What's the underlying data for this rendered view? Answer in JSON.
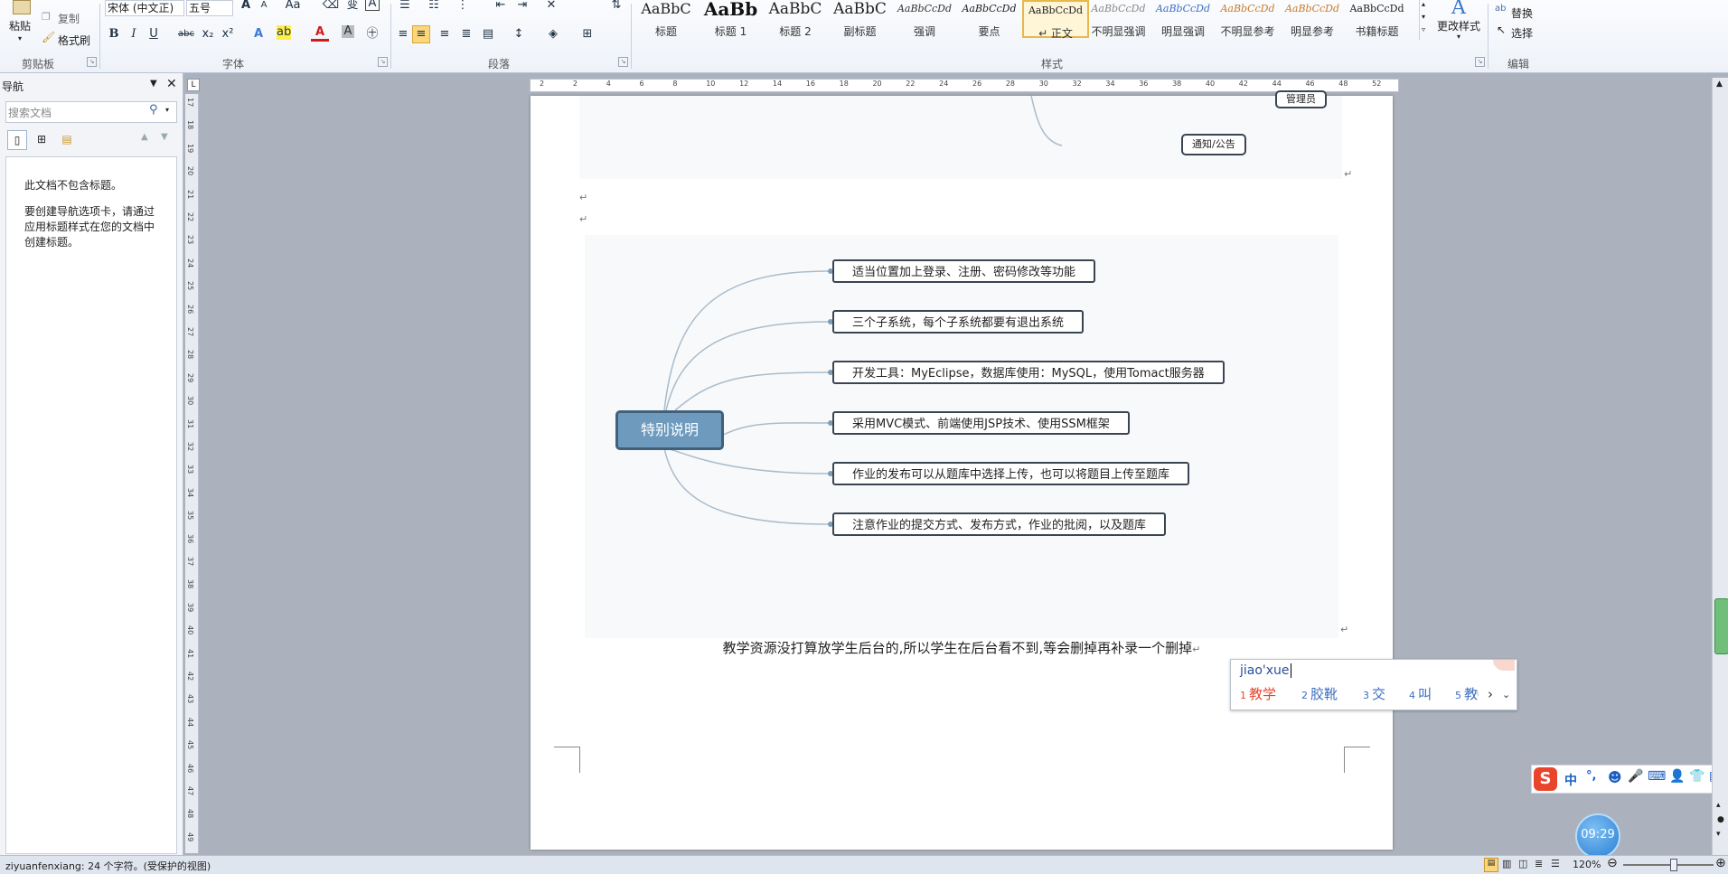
{
  "ribbon": {
    "clipboard": {
      "paste": "粘贴",
      "copy": "复制",
      "format_painter": "格式刷",
      "label": "剪贴板"
    },
    "font": {
      "name": "宋体 (中文正)",
      "size": "五号",
      "label": "字体",
      "bold": "B",
      "italic": "I",
      "underline": "U",
      "strike": "abc",
      "sub": "x₂",
      "sup": "x²",
      "font_color": "A"
    },
    "paragraph": {
      "label": "段落"
    },
    "styles": {
      "label": "样式",
      "items": [
        {
          "sample": "AaBbC",
          "name": "标题"
        },
        {
          "sample": "AaBb",
          "name": "标题 1"
        },
        {
          "sample": "AaBbC",
          "name": "标题 2"
        },
        {
          "sample": "AaBbC",
          "name": "副标题"
        },
        {
          "sample": "AaBbCcDd",
          "name": "强调"
        },
        {
          "sample": "AaBbCcDd",
          "name": "要点"
        },
        {
          "sample": "AaBbCcDd",
          "name": "↵ 正文"
        },
        {
          "sample": "AaBbCcDd",
          "name": "不明显强调"
        },
        {
          "sample": "AaBbCcDd",
          "name": "明显强调"
        },
        {
          "sample": "AaBbCcDd",
          "name": "不明显参考"
        },
        {
          "sample": "AaBbCcDd",
          "name": "明显参考"
        },
        {
          "sample": "AaBbCcDd",
          "name": "书籍标题"
        }
      ],
      "change_styles": "更改样式"
    },
    "editing": {
      "replace": "替换",
      "select": "选择",
      "label": "编辑"
    }
  },
  "nav": {
    "title": "导航",
    "search_placeholder": "搜索文档",
    "msg1": "此文档不包含标题。",
    "msg2": "要创建导航选项卡，请通过应用标题样式在您的文档中创建标题。"
  },
  "ruler": {
    "ticks": [
      "2",
      "2",
      "4",
      "6",
      "8",
      "10",
      "12",
      "14",
      "16",
      "18",
      "20",
      "22",
      "24",
      "26",
      "28",
      "30",
      "32",
      "34",
      "36",
      "38",
      "40",
      "42",
      "44",
      "46",
      "48",
      "52"
    ],
    "vticks": [
      "17",
      "18",
      "19",
      "20",
      "21",
      "22",
      "23",
      "24",
      "25",
      "26",
      "27",
      "28",
      "29",
      "30",
      "31",
      "32",
      "33",
      "34",
      "35",
      "36",
      "37",
      "38",
      "39",
      "40",
      "41",
      "42",
      "43",
      "44",
      "45",
      "46",
      "47",
      "48",
      "49"
    ]
  },
  "document": {
    "map1": {
      "node_admin": "管理员",
      "node_notice": "通知/公告"
    },
    "map2": {
      "root": "特别说明",
      "children": [
        "适当位置加上登录、注册、密码修改等功能",
        "三个子系统，每个子系统都要有退出系统",
        "开发工具：MyEclipse，数据库使用：MySQL，使用Tomact服务器",
        "采用MVC模式、前端使用JSP技术、使用SSM框架",
        "作业的发布可以从题库中选择上传，也可以将题目上传至题库",
        "注意作业的提交方式、发布方式，作业的批阅，以及题库"
      ]
    },
    "paragraph": "教学资源没打算放学生后台的,所以学生在后台看不到,等会删掉再补录一个删掉",
    "para_mark": "↵"
  },
  "ime": {
    "input": "jiao'xue",
    "candidates": [
      {
        "idx": "1",
        "text": "教学"
      },
      {
        "idx": "2",
        "text": "胶靴"
      },
      {
        "idx": "3",
        "text": "交"
      },
      {
        "idx": "4",
        "text": "叫"
      },
      {
        "idx": "5",
        "text": "教"
      }
    ],
    "toolbar_lang": "中",
    "toolbar_punct": "°,"
  },
  "clock": "09:29",
  "status": {
    "text": "ziyuanfenxiang: 24 个字符。(受保护的视图)",
    "zoom": "120%"
  },
  "colors": {
    "accent": "#6e9bbd",
    "selected_style": "#fbd77a",
    "ime_red": "#e8452c",
    "ime_blue": "#3b6fc2"
  }
}
